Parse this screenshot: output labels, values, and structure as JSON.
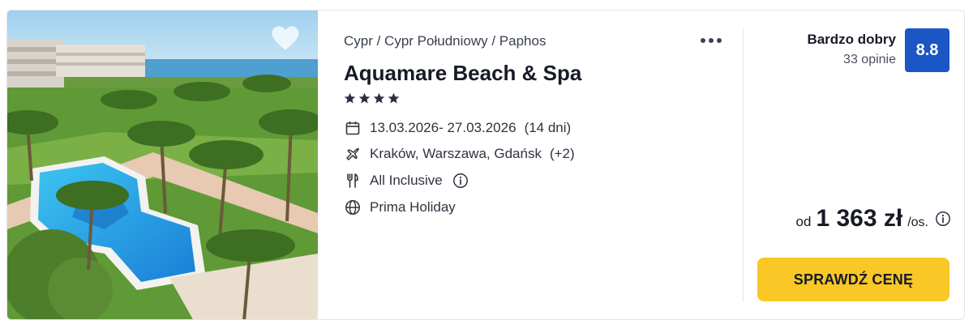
{
  "hotel": {
    "breadcrumb": "Cypr / Cypr Południowy / Paphos",
    "name": "Aquamare Beach & Spa",
    "stars": 4,
    "dates": "13.03.2026- 27.03.2026",
    "duration": "(14 dni)",
    "departure_airports": "Kraków, Warszawa, Gdańsk",
    "departure_more": "(+2)",
    "board": "All Inclusive",
    "tour_operator": "Prima Holiday"
  },
  "rating": {
    "label": "Bardzo dobry",
    "count": "33 opinie",
    "score": "8.8"
  },
  "price": {
    "prefix": "od",
    "amount": "1 363 zł",
    "suffix": "/os."
  },
  "cta": {
    "label": "SPRAWDŹ CENĘ"
  },
  "icons": {
    "favorite": "heart-icon",
    "more": "more-options-icon",
    "star": "star-icon",
    "dates": "calendar-icon",
    "airports": "plane-icon",
    "board": "cutlery-icon",
    "info": "info-icon",
    "operator": "globe-icon"
  },
  "colors": {
    "rating_badge": "#1a56c4",
    "cta_background": "#f9c726",
    "text_primary": "#171b26"
  }
}
